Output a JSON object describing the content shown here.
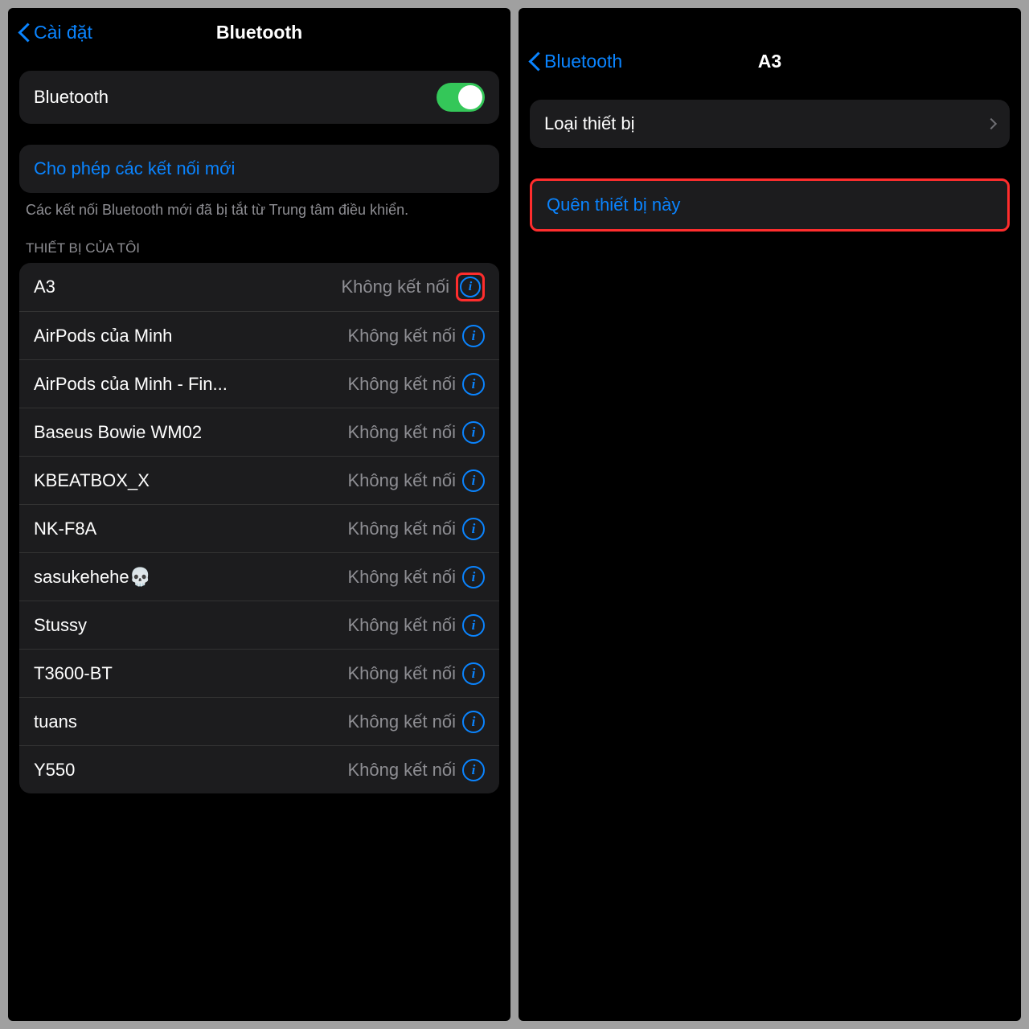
{
  "left": {
    "back_label": "Cài đặt",
    "title": "Bluetooth",
    "toggle_label": "Bluetooth",
    "allow_new_label": "Cho phép các kết nối mới",
    "footer_note": "Các kết nối Bluetooth mới đã bị tắt từ Trung tâm điều khiển.",
    "devices_header": "THIẾT BỊ CỦA TÔI",
    "status_label": "Không kết nối",
    "devices": [
      {
        "name": "A3",
        "highlight_info": true
      },
      {
        "name": "AirPods của Minh"
      },
      {
        "name": "AirPods của Minh - Fin..."
      },
      {
        "name": "Baseus Bowie WM02"
      },
      {
        "name": "KBEATBOX_X"
      },
      {
        "name": "NK-F8A"
      },
      {
        "name": "sasukehehe💀"
      },
      {
        "name": "Stussy"
      },
      {
        "name": "T3600-BT"
      },
      {
        "name": "tuans"
      },
      {
        "name": "Y550"
      }
    ]
  },
  "right": {
    "back_label": "Bluetooth",
    "title": "A3",
    "device_type_label": "Loại thiết bị",
    "forget_label": "Quên thiết bị này"
  }
}
